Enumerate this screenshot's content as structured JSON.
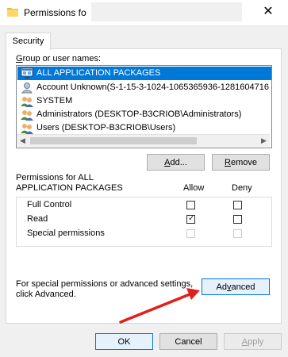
{
  "window": {
    "title": "Permissions fo",
    "close_glyph": "✕"
  },
  "tabs": [
    {
      "label": "Security"
    }
  ],
  "group_users": {
    "label_prefix": "",
    "label_mnemonic": "G",
    "label_rest": "roup or user names:",
    "items": [
      {
        "name": "ALL APPLICATION PACKAGES",
        "icon": "app-packages-icon",
        "selected": true
      },
      {
        "name": "Account Unknown(S-1-15-3-1024-1065365936-1281604716",
        "icon": "unknown-user-icon",
        "selected": false
      },
      {
        "name": "SYSTEM",
        "icon": "users-group-icon",
        "selected": false
      },
      {
        "name": "Administrators (DESKTOP-B3CRIOB\\Administrators)",
        "icon": "users-group-icon",
        "selected": false
      },
      {
        "name": "Users (DESKTOP-B3CRIOB\\Users)",
        "icon": "users-group-icon",
        "selected": false
      }
    ]
  },
  "buttons": {
    "add_mn": "A",
    "add_rest": "dd...",
    "remove_mn": "R",
    "remove_rest": "emove",
    "advanced_mn": "v",
    "advanced_pre": "Ad",
    "advanced_rest": "anced",
    "ok": "OK",
    "cancel": "Cancel",
    "apply_mn": "A",
    "apply_rest": "pply"
  },
  "permissions": {
    "header_line1": "Permissions for ALL",
    "header_line2": "APPLICATION PACKAGES",
    "allow_label": "Allow",
    "deny_label": "Deny",
    "rows": [
      {
        "name": "Full Control",
        "allow": false,
        "deny": false,
        "disabled": false
      },
      {
        "name": "Read",
        "allow": true,
        "deny": false,
        "disabled": false
      },
      {
        "name": "Special permissions",
        "allow": false,
        "deny": false,
        "disabled": true
      }
    ]
  },
  "advanced_hint": {
    "line1": "For special permissions or advanced settings,",
    "line2": "click Advanced."
  },
  "colors": {
    "selection": "#0078d7",
    "annotation_arrow": "#e0201b"
  }
}
